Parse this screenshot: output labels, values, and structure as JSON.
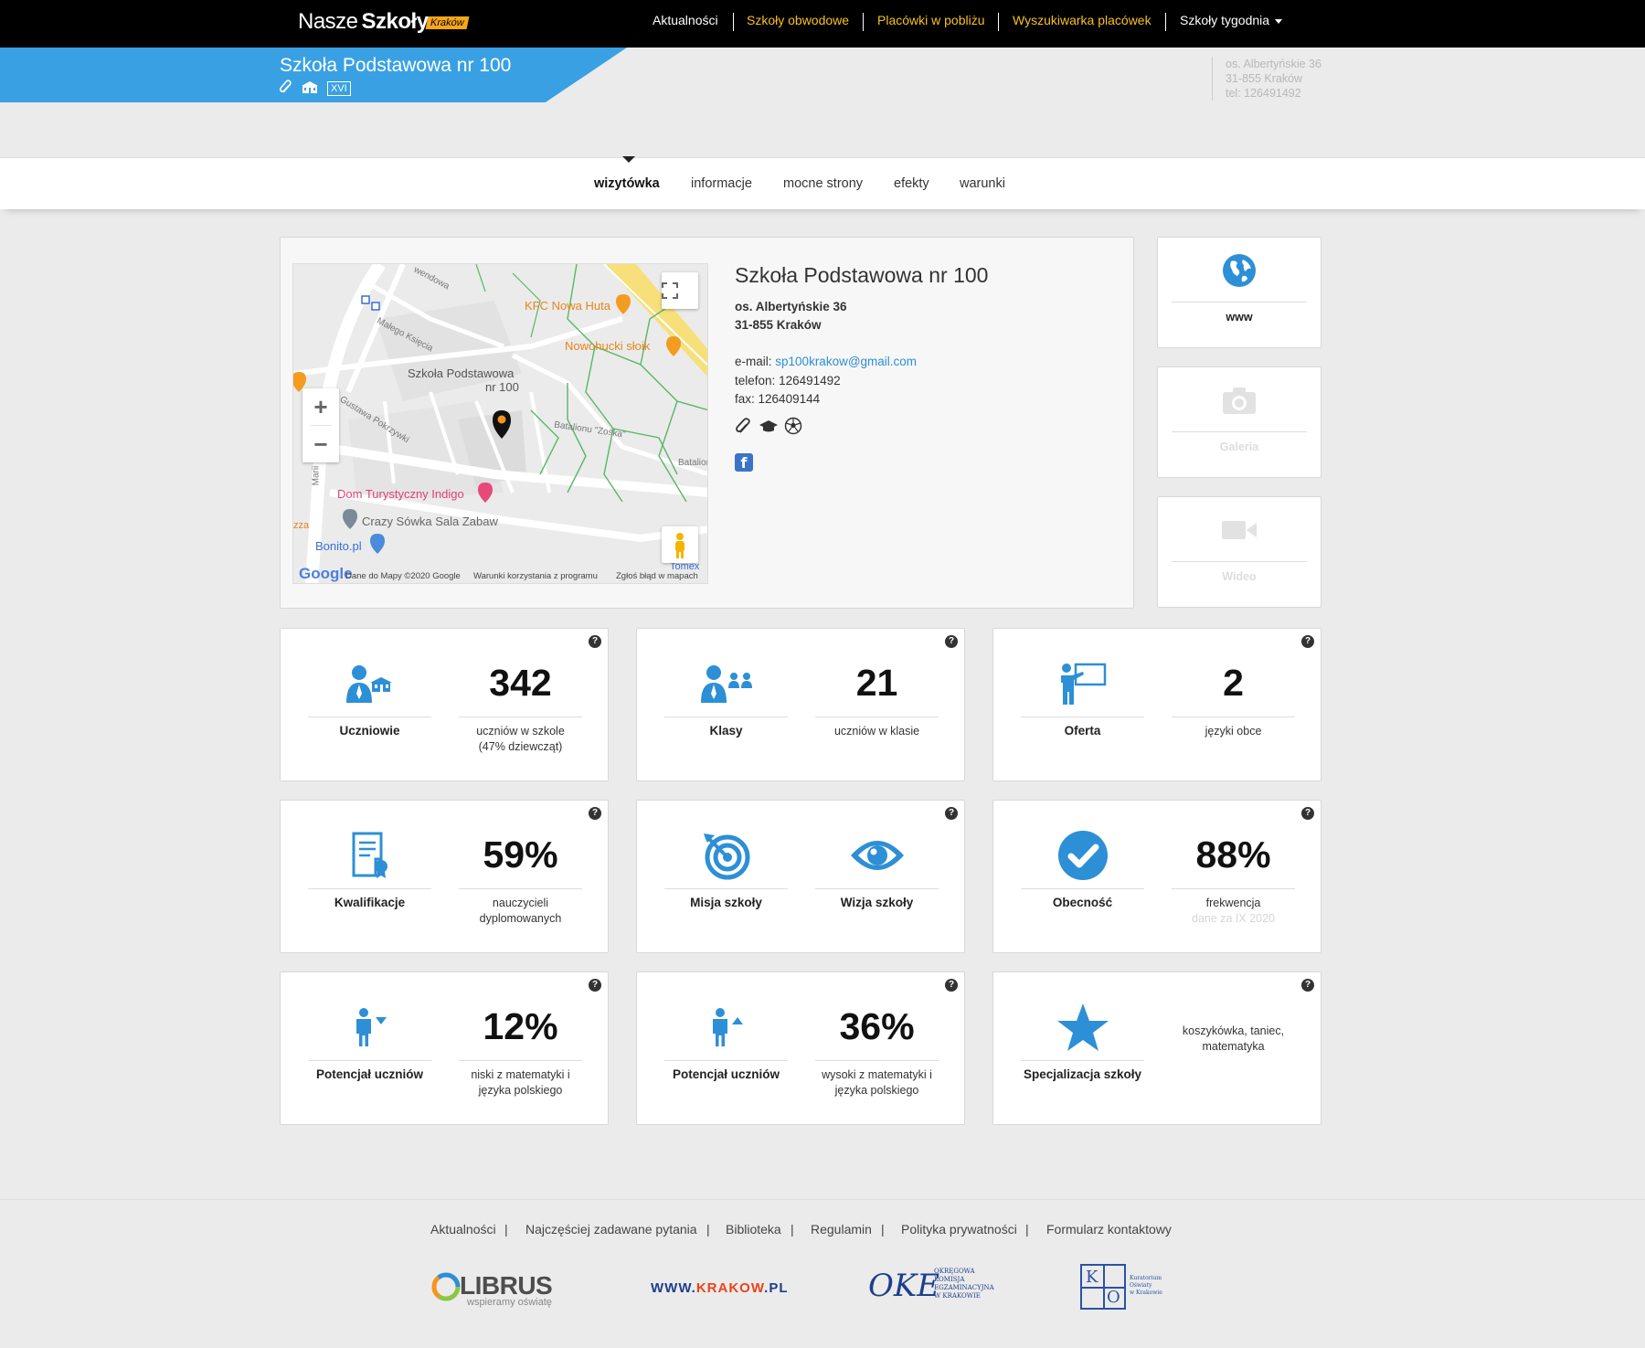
{
  "header": {
    "logo": {
      "part1": "Nasze",
      "part2": "Szkoły",
      "city_tag": "Kraków"
    },
    "nav": [
      {
        "label": "Aktualności"
      },
      {
        "label": "Szkoły obwodowe"
      },
      {
        "label": "Placówki w pobliżu"
      },
      {
        "label": "Wyszukiwarka placówek"
      },
      {
        "label": "Szkoły tygodnia"
      }
    ]
  },
  "banner": {
    "title": "Szkoła Podstawowa nr 100",
    "district": "XVI",
    "address_lines": [
      "os. Albertyńskie 36",
      "31-855 Kraków",
      "tel: 126491492"
    ]
  },
  "tabs": [
    {
      "label": "wizytówka",
      "active": true
    },
    {
      "label": "informacje"
    },
    {
      "label": "mocne strony"
    },
    {
      "label": "efekty"
    },
    {
      "label": "warunki"
    }
  ],
  "map": {
    "labels": {
      "street_wendowa": "wendowa",
      "kfc": "KFC Nowa Huta",
      "nowohucki": "Nowohucki słoik",
      "malego_ksiecia": "Małego Księcia",
      "school_line1": "Szkoła Podstawowa",
      "school_line2": "nr 100",
      "gustawa": "Gustawa Pokrzywki",
      "batalionu_zoska": "Batalionu \"Zośka\"",
      "batalion": "Batalion",
      "marii": "Marii",
      "dom_turystyczny": "Dom Turystyczny Indigo",
      "crazy_sowka": "Crazy Sówka Sala Zabaw",
      "bonito": "Bonito.pl",
      "zza": "zza",
      "tomex": "Tomex"
    },
    "footer": {
      "google": "Google",
      "data": "Dane do Mapy ©2020 Google",
      "terms": "Warunki korzystania z programu",
      "report": "Zgłoś błąd w mapach"
    }
  },
  "info": {
    "name": "Szkoła Podstawowa nr 100",
    "address1": "os. Albertyńskie 36",
    "address2": "31-855 Kraków",
    "email_label": "e-mail:",
    "email": "sp100krakow@gmail.com",
    "phone_label": "telefon:",
    "phone": "126491492",
    "fax_label": "fax:",
    "fax": "126409144"
  },
  "side": [
    {
      "label": "www",
      "icon": "globe-icon"
    },
    {
      "label": "Galeria",
      "icon": "camera-icon"
    },
    {
      "label": "Wideo",
      "icon": "video-icon"
    }
  ],
  "stats": [
    {
      "label": "Uczniowie",
      "value": "342",
      "sub1": "uczniów w szkole",
      "sub2": "(47% dziewcząt)"
    },
    {
      "label": "Klasy",
      "value": "21",
      "sub1": "uczniów w klasie"
    },
    {
      "label": "Oferta",
      "value": "2",
      "sub1": "języki obce"
    },
    {
      "label": "Kwalifikacje",
      "value": "59%",
      "sub1": "nauczycieli",
      "sub2": "dyplomowanych"
    },
    {
      "label": "Misja szkoły",
      "label2": "Wizja szkoły"
    },
    {
      "label": "Obecność",
      "value": "88%",
      "sub1": "frekwencja",
      "sub2": "dane za IX 2020"
    },
    {
      "label": "Potencjał uczniów",
      "value": "12%",
      "sub1": "niski z matematyki i",
      "sub2": "języka polskiego"
    },
    {
      "label": "Potencjał uczniów",
      "value": "36%",
      "sub1": "wysoki z matematyki i",
      "sub2": "języka polskiego"
    },
    {
      "label": "Specjalizacja szkoły",
      "sub1": "koszykówka, taniec,",
      "sub2": "matematyka"
    }
  ],
  "help_mark": "?",
  "footer": {
    "links": [
      "Aktualności",
      "Najczęściej zadawane pytania",
      "Biblioteka",
      "Regulamin",
      "Polityka prywatności",
      "Formularz kontaktowy"
    ],
    "logos": {
      "librus": "LIBRUS",
      "librus_tag": "wspieramy oświatę",
      "krakow_www": "WWW.",
      "krakow_name": "KRAKOW",
      "krakow_tld": ".PL",
      "oke_mark": "OKE",
      "oke_text": [
        "OKRĘGOWA",
        "KOMISJA",
        "EGZAMINACYJNA",
        "W KRAKOWIE"
      ],
      "ko_letters": [
        "K",
        "O"
      ],
      "ko_text": [
        "Kuratorium",
        "Oświaty",
        "w Krakowie"
      ]
    }
  },
  "colors": {
    "accent": "#39a1e3",
    "nav_yellow": "#f7c21a",
    "icon_blue": "#2d8fd5"
  }
}
